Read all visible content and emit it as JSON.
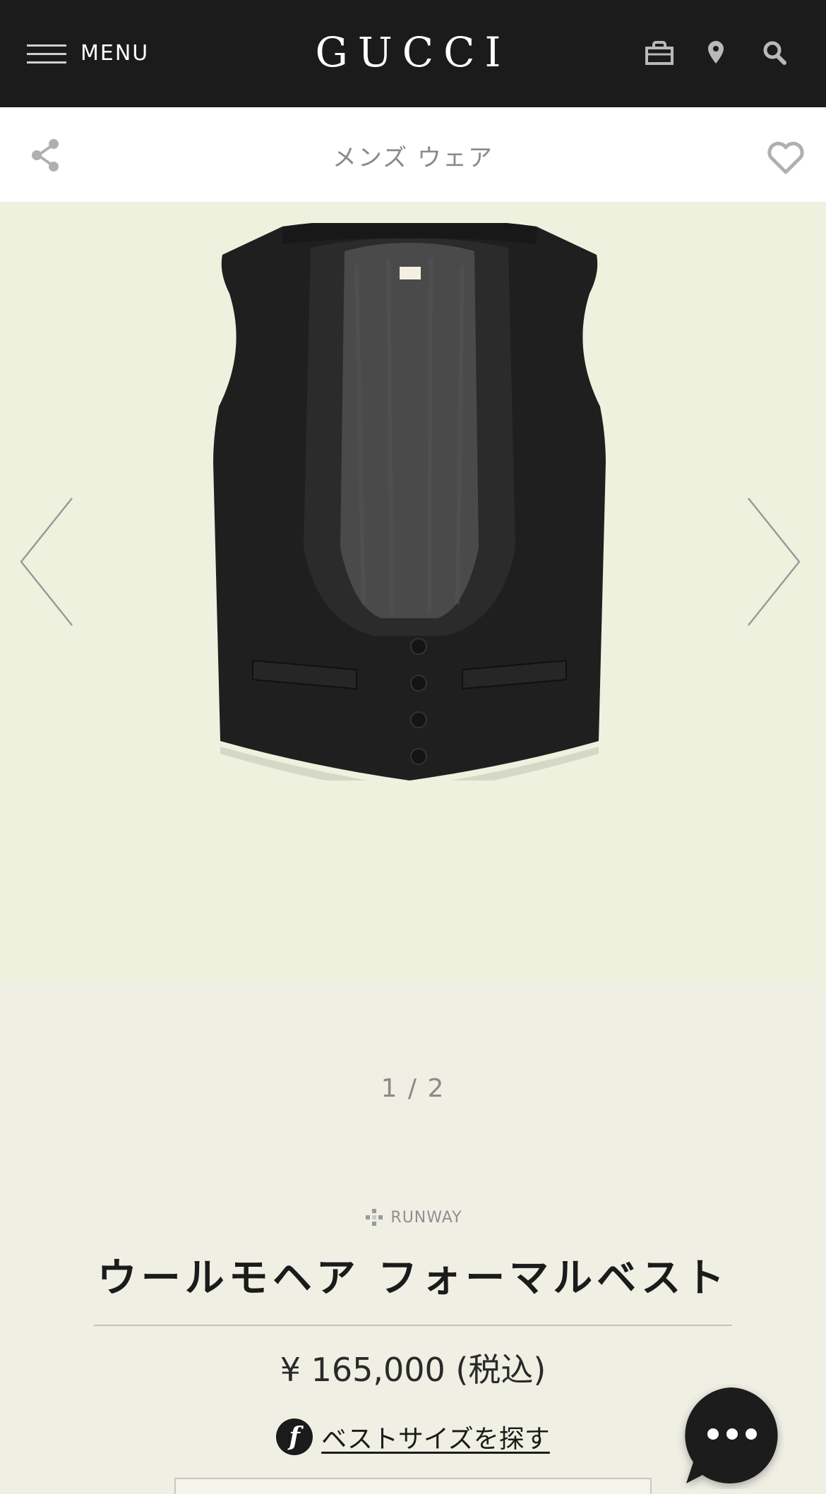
{
  "header": {
    "menu_label": "MENU",
    "logo_text": "GUCCI",
    "icons": [
      "hamburger-icon",
      "shopping-bag-icon",
      "location-pin-icon",
      "search-icon"
    ]
  },
  "subheader": {
    "category": "メンズ ウェア",
    "icons": [
      "share-icon",
      "heart-icon"
    ]
  },
  "gallery": {
    "image_subject": "black vest",
    "pager": "1 / 2",
    "background_color": "#eff1df",
    "icons": [
      "chevron-left-icon",
      "chevron-right-icon"
    ]
  },
  "product": {
    "badge": "RUNWAY",
    "name": "ウールモヘア フォーマルベスト",
    "price": "¥ 165,000 (税込)",
    "size_link_icon_text": "f",
    "size_link": "ベストサイズを探す"
  },
  "chat": {
    "icon": "chat-bubble-icon"
  },
  "colors": {
    "header_bg": "#1b1b1b",
    "page_bg": "#efefe4",
    "muted_text": "#8a8a8a"
  }
}
